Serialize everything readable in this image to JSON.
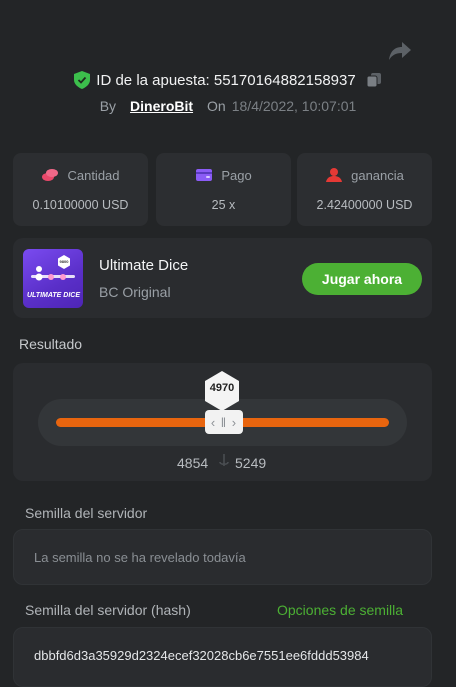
{
  "header": {
    "bet_id_label": "ID de la apuesta: 55170164882158937",
    "by_label": "By",
    "user": "DineroBit",
    "on_label": "On",
    "date": "18/4/2022, 10:07:01"
  },
  "stats": [
    {
      "title": "Cantidad",
      "value": "0.10100000 USD",
      "icon": "coins-icon",
      "color": "#e9486a"
    },
    {
      "title": "Pago",
      "value": "25 x",
      "icon": "wallet-icon",
      "color": "#8b5cf6"
    },
    {
      "title": "ganancia",
      "value": "2.42400000 USD",
      "icon": "profit-icon",
      "color": "#e53935"
    }
  ],
  "game": {
    "thumb_text": "ULTIMATE DICE",
    "thumb_badge": "9800",
    "name": "Ultimate Dice",
    "provider": "BC Original",
    "play_label": "Jugar ahora"
  },
  "result": {
    "label": "Resultado",
    "value": "4970",
    "range_low": "4854",
    "range_high": "5249",
    "slider_fill_fraction": 1.0
  },
  "seed": {
    "server_label": "Semilla del servidor",
    "server_placeholder": "La semilla no se ha revelado todavía",
    "hash_label": "Semilla del servidor (hash)",
    "options_label": "Opciones de semilla",
    "hash_value": "dbbfd6d3a35929d2324ecef32028cb6e7551ee6fddd53984"
  },
  "colors": {
    "accent_green": "#4cb034",
    "slider_orange": "#e8650f",
    "background": "#232527",
    "panel": "#2a2c2f"
  }
}
